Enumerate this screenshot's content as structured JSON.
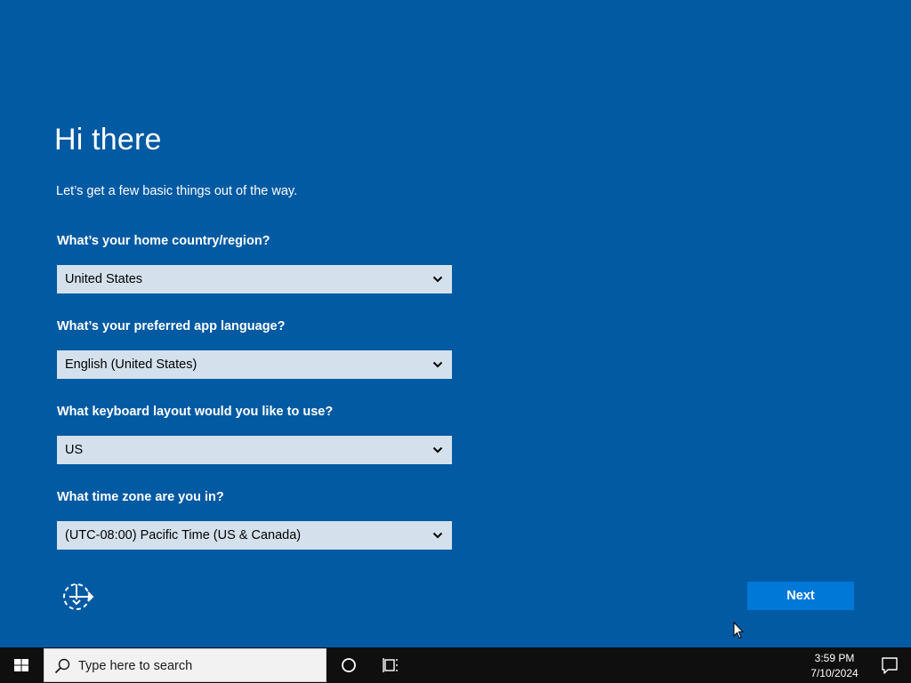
{
  "page": {
    "title": "Hi there",
    "subtitle": "Let’s get a few basic things out of the way."
  },
  "questions": [
    {
      "label": "What’s your home country/region?",
      "value": "United States"
    },
    {
      "label": "What’s your preferred app language?",
      "value": "English (United States)"
    },
    {
      "label": "What keyboard layout would you like to use?",
      "value": "US"
    },
    {
      "label": "What time zone are you in?",
      "value": "(UTC-08:00) Pacific Time (US & Canada)"
    }
  ],
  "buttons": {
    "next_label": "Next"
  },
  "taskbar": {
    "search_placeholder": "Type here to search",
    "time": "3:59 PM",
    "date": "7/10/2024"
  },
  "colors": {
    "background": "#025aa3",
    "dropdown": "#d4e1ec",
    "accent_button": "#0078d7",
    "taskbar": "#0f0f10"
  },
  "icons": {
    "chevron": "chevron-down-icon",
    "accessibility": "ease-of-access-icon",
    "start": "windows-logo-icon",
    "search": "search-icon",
    "cortana": "cortana-circle-icon",
    "task_view": "task-view-icon",
    "notifications": "action-center-icon",
    "pointer": "mouse-pointer-icon"
  }
}
